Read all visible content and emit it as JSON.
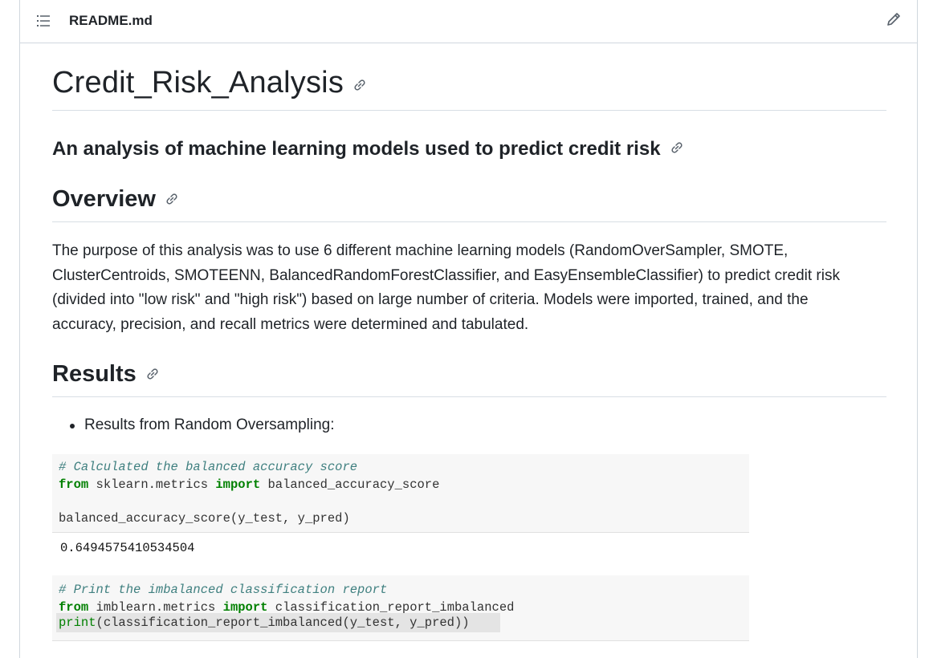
{
  "header": {
    "filename": "README.md",
    "toc_icon": "list-icon",
    "edit_icon": "pencil-icon"
  },
  "readme": {
    "title": "Credit_Risk_Analysis",
    "subtitle": "An analysis of machine learning models used to predict credit risk",
    "overview_heading": "Overview",
    "overview_text": "The purpose of this analysis was to use 6 different machine learning models (RandomOverSampler, SMOTE, ClusterCentroids, SMOTEENN, BalancedRandomForestClassifier, and EasyEnsembleClassifier) to predict credit risk (divided into \"low risk\" and \"high risk\") based on large number of criteria. Models were imported, trained, and the accuracy, precision, and recall metrics were determined and tabulated.",
    "results_heading": "Results",
    "bullet_1": "Results from Random Oversampling:",
    "anchor_icon": "link-icon"
  },
  "code1": {
    "comment": "# Calculated the balanced accuracy score",
    "kw_from": "from",
    "module": " sklearn.metrics ",
    "kw_import": "import",
    "name": " balanced_accuracy_score",
    "call": "balanced_accuracy_score(y_test, y_pred)"
  },
  "output1": "0.6494575410534504",
  "code2": {
    "comment": "# Print the imbalanced classification report",
    "kw_from": "from",
    "module": " imblearn.metrics ",
    "kw_import": "import",
    "name": " classification_report_imbalanced",
    "print_fn": "print",
    "print_args": "(classification_report_imbalanced(y_test, y_pred))"
  }
}
